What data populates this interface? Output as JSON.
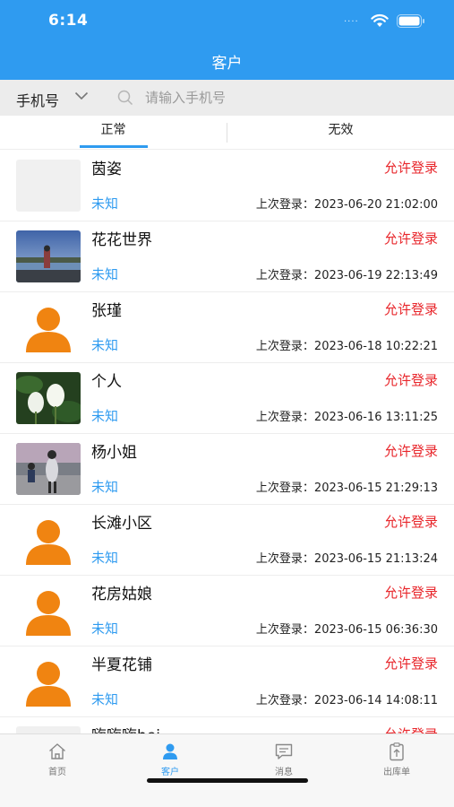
{
  "status_bar": {
    "time": "6:14",
    "dots": "····"
  },
  "header": {
    "title": "客户"
  },
  "search": {
    "field_select": "手机号",
    "placeholder": "请输入手机号"
  },
  "tabs": [
    {
      "label": "正常"
    },
    {
      "label": "无效"
    }
  ],
  "customers": [
    {
      "name": "茵姿",
      "status": "允许登录",
      "tag": "未知",
      "last_login": "上次登录：2023-06-20 21:02:00",
      "avatar": "blank"
    },
    {
      "name": "花花世界",
      "status": "允许登录",
      "tag": "未知",
      "last_login": "上次登录：2023-06-19 22:13:49",
      "avatar": "photo-lake"
    },
    {
      "name": "张瑾",
      "status": "允许登录",
      "tag": "未知",
      "last_login": "上次登录：2023-06-18 10:22:21",
      "avatar": "default-person"
    },
    {
      "name": "个人",
      "status": "允许登录",
      "tag": "未知",
      "last_login": "上次登录：2023-06-16 13:11:25",
      "avatar": "photo-lotus"
    },
    {
      "name": "杨小姐",
      "status": "允许登录",
      "tag": "未知",
      "last_login": "上次登录：2023-06-15 21:29:13",
      "avatar": "photo-family"
    },
    {
      "name": "长滩小区",
      "status": "允许登录",
      "tag": "未知",
      "last_login": "上次登录：2023-06-15 21:13:24",
      "avatar": "default-person"
    },
    {
      "name": "花房姑娘",
      "status": "允许登录",
      "tag": "未知",
      "last_login": "上次登录：2023-06-15 06:36:30",
      "avatar": "default-person"
    },
    {
      "name": "半夏花铺",
      "status": "允许登录",
      "tag": "未知",
      "last_login": "上次登录：2023-06-14 14:08:11",
      "avatar": "default-person"
    },
    {
      "name": "嗨嗨嗨hei",
      "status": "允许登录",
      "tag": "",
      "last_login": "",
      "avatar": "blank"
    }
  ],
  "tabbar": [
    {
      "label": "首页",
      "icon": "home-icon",
      "active": false
    },
    {
      "label": "客户",
      "icon": "person-icon",
      "active": true
    },
    {
      "label": "消息",
      "icon": "message-icon",
      "active": false
    },
    {
      "label": "出库单",
      "icon": "clipboard-icon",
      "active": false
    }
  ],
  "colors": {
    "accent": "#2f9bf0",
    "allow": "#e8262b",
    "avatar_default": "#f08411"
  }
}
